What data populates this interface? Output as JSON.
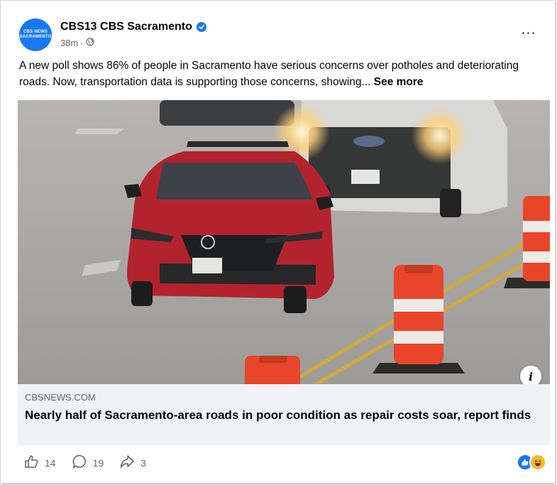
{
  "post": {
    "page_name": "CBS13 CBS Sacramento",
    "avatar_text": "CBS NEWS\nSACRAMENTO",
    "timestamp": "38m",
    "separator": "·",
    "text": "A new poll shows 86% of people in Sacramento have serious concerns over potholes and deteriorating roads. Now, transportation data is supporting those concerns, showing...",
    "see_more_label": "See more",
    "options_label": "···"
  },
  "link_preview": {
    "domain": "CBSNEWS.COM",
    "headline": "Nearly half of Sacramento-area roads in poor condition as repair costs soar, report finds",
    "info_label": "i"
  },
  "footer": {
    "like_count": "14",
    "comment_count": "19",
    "share_count": "3"
  },
  "colors": {
    "brand": "#1877f2",
    "muted": "#65676b",
    "cone_orange": "#e8452a"
  }
}
